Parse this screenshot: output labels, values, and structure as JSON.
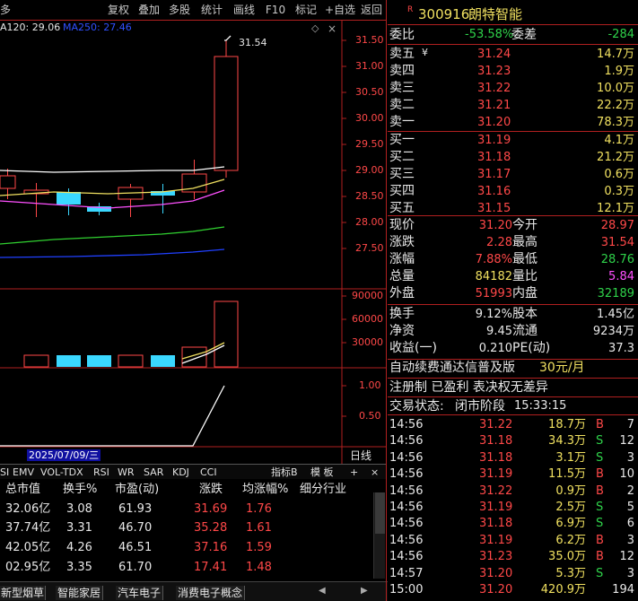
{
  "toolbar": {
    "menu": "多",
    "items": [
      "复权",
      "叠加",
      "多股",
      "统计",
      "画线",
      "F10",
      "标记",
      "+自选",
      "返回"
    ]
  },
  "ma_legend": {
    "ma120": "A120: 29.06",
    "ma250": "MA250: 27.46"
  },
  "price_axis": {
    "ticks": [
      "31.50",
      "31.00",
      "30.50",
      "30.00",
      "29.50",
      "29.00",
      "28.50",
      "28.00",
      "27.50"
    ],
    "high_label": "31.54"
  },
  "vol_axis": {
    "ticks": [
      "90000",
      "60000",
      "30000"
    ]
  },
  "ind_axis": {
    "ticks": [
      "1.00",
      "0.50"
    ]
  },
  "date_label": "2025/07/09/三",
  "period_label": "日线",
  "indicator_tabs": [
    "SI",
    "EMV",
    "VOL-TDX",
    "RSI",
    "WR",
    "SAR",
    "KDJ",
    "CCI"
  ],
  "indicator_right": {
    "more": "指标B",
    "template": "模 板",
    "add": "+",
    "remove": "×"
  },
  "table": {
    "headers": [
      "总市值",
      "换手%",
      "市盈(动)",
      "涨跌",
      "均涨幅%",
      "细分行业"
    ],
    "rows": [
      [
        "32.06亿",
        "3.08",
        "61.93",
        "31.69",
        "1.76"
      ],
      [
        "37.74亿",
        "3.31",
        "46.70",
        "35.28",
        "1.61"
      ],
      [
        "42.05亿",
        "4.26",
        "46.51",
        "37.16",
        "1.59"
      ],
      [
        "02.95亿",
        "3.35",
        "61.70",
        "17.41",
        "1.48"
      ]
    ]
  },
  "bottom_tabs": [
    "新型烟草",
    "智能家居",
    "汽车电子",
    "消费电子概念"
  ],
  "stock": {
    "badge": "R",
    "code": "300916",
    "name": "朗特智能"
  },
  "weibi": {
    "label": "委比",
    "value": "-53.58%",
    "label2": "委差",
    "value2": "-284"
  },
  "sell": [
    {
      "label": "卖五",
      "sub": "¥",
      "price": "31.24",
      "vol": "14.7万"
    },
    {
      "label": "卖四",
      "sub": "",
      "price": "31.23",
      "vol": "1.9万"
    },
    {
      "label": "卖三",
      "sub": "",
      "price": "31.22",
      "vol": "10.0万"
    },
    {
      "label": "卖二",
      "sub": "",
      "price": "31.21",
      "vol": "22.2万"
    },
    {
      "label": "卖一",
      "sub": "",
      "price": "31.20",
      "vol": "78.3万"
    }
  ],
  "buy": [
    {
      "label": "买一",
      "price": "31.19",
      "vol": "4.1万"
    },
    {
      "label": "买二",
      "price": "31.18",
      "vol": "21.2万"
    },
    {
      "label": "买三",
      "price": "31.17",
      "vol": "0.6万"
    },
    {
      "label": "买四",
      "price": "31.16",
      "vol": "0.3万"
    },
    {
      "label": "买五",
      "price": "31.15",
      "vol": "12.1万"
    }
  ],
  "quote": [
    {
      "l1": "现价",
      "v1": "31.20",
      "c1": "r",
      "l2": "今开",
      "v2": "28.97",
      "c2": "r"
    },
    {
      "l1": "涨跌",
      "v1": "2.28",
      "c1": "r",
      "l2": "最高",
      "v2": "31.54",
      "c2": "r"
    },
    {
      "l1": "涨幅",
      "v1": "7.88%",
      "c1": "r",
      "l2": "最低",
      "v2": "28.76",
      "c2": "g"
    },
    {
      "l1": "总量",
      "v1": "84182",
      "c1": "y",
      "l2": "量比",
      "v2": "5.84",
      "c2": "m"
    },
    {
      "l1": "外盘",
      "v1": "51993",
      "c1": "r",
      "l2": "内盘",
      "v2": "32189",
      "c2": "g"
    }
  ],
  "fin": [
    {
      "l1": "换手",
      "v1": "9.12%",
      "l2": "股本",
      "v2": "1.45亿"
    },
    {
      "l1": "净资",
      "v1": "9.45",
      "l2": "流通",
      "v2": "9234万"
    },
    {
      "l1": "收益(一)",
      "v1": "0.210",
      "l2": "PE(动)",
      "v2": "37.3"
    }
  ],
  "promo": {
    "text": "自动续费通达信普及版",
    "price": "30元/月"
  },
  "reg": "注册制 已盈利 表决权无差异",
  "status": {
    "label": "交易状态:",
    "value": "闭市阶段",
    "time": "15:33:15"
  },
  "trades": [
    {
      "time": "14:56",
      "price": "31.22",
      "vol": "18.7万",
      "bs": "B",
      "n": "7"
    },
    {
      "time": "14:56",
      "price": "31.18",
      "vol": "34.3万",
      "bs": "S",
      "n": "12"
    },
    {
      "time": "14:56",
      "price": "31.18",
      "vol": "3.1万",
      "bs": "S",
      "n": "3"
    },
    {
      "time": "14:56",
      "price": "31.19",
      "vol": "11.5万",
      "bs": "B",
      "n": "10"
    },
    {
      "time": "14:56",
      "price": "31.22",
      "vol": "0.9万",
      "bs": "B",
      "n": "2"
    },
    {
      "time": "14:56",
      "price": "31.19",
      "vol": "2.5万",
      "bs": "S",
      "n": "5"
    },
    {
      "time": "14:56",
      "price": "31.18",
      "vol": "6.9万",
      "bs": "S",
      "n": "6"
    },
    {
      "time": "14:56",
      "price": "31.19",
      "vol": "6.2万",
      "bs": "B",
      "n": "3"
    },
    {
      "time": "14:56",
      "price": "31.23",
      "vol": "35.0万",
      "bs": "B",
      "n": "12"
    },
    {
      "time": "14:57",
      "price": "31.20",
      "vol": "5.3万",
      "bs": "S",
      "n": "3"
    },
    {
      "time": "15:00",
      "price": "31.20",
      "vol": "420.9万",
      "bs": "",
      "n": "194"
    }
  ],
  "colors": {
    "up": "#ff4848",
    "down": "#3ad8ff",
    "grid": "#b02020",
    "ma1": "#ffffff",
    "ma2": "#f0e060",
    "ma3": "#ff50ff",
    "ma4": "#30d030",
    "ma5": "#2040ff"
  }
}
